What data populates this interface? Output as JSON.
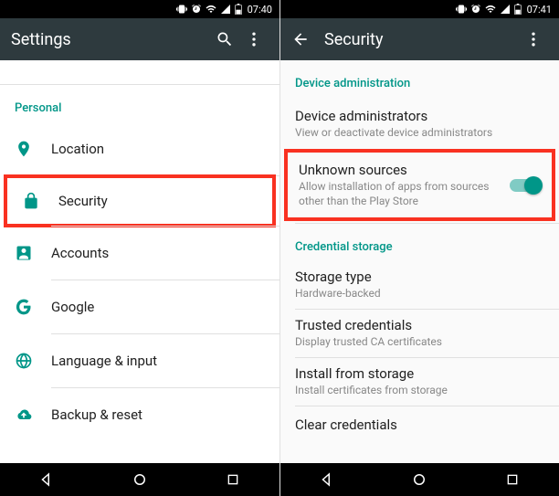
{
  "colors": {
    "accent": "#009688",
    "highlight": "#f93121"
  },
  "left": {
    "status_time": "07:40",
    "app_title": "Settings",
    "section": "Personal",
    "items": [
      {
        "label": "Location",
        "icon": "place-icon"
      },
      {
        "label": "Security",
        "icon": "lock-icon"
      },
      {
        "label": "Accounts",
        "icon": "account-icon"
      },
      {
        "label": "Google",
        "icon": "google-icon"
      },
      {
        "label": "Language & input",
        "icon": "language-icon"
      },
      {
        "label": "Backup & reset",
        "icon": "backup-icon"
      }
    ]
  },
  "right": {
    "status_time": "07:41",
    "app_title": "Security",
    "sections": {
      "device_admin": {
        "header": "Device administration",
        "items": [
          {
            "label": "Device administrators",
            "sub": "View or deactivate device administrators"
          },
          {
            "label": "Unknown sources",
            "sub": "Allow installation of apps from sources other than the Play Store",
            "toggle_on": true
          }
        ]
      },
      "cred_storage": {
        "header": "Credential storage",
        "items": [
          {
            "label": "Storage type",
            "sub": "Hardware-backed"
          },
          {
            "label": "Trusted credentials",
            "sub": "Display trusted CA certificates"
          },
          {
            "label": "Install from storage",
            "sub": "Install certificates from storage"
          },
          {
            "label": "Clear credentials",
            "sub": ""
          }
        ]
      }
    }
  }
}
